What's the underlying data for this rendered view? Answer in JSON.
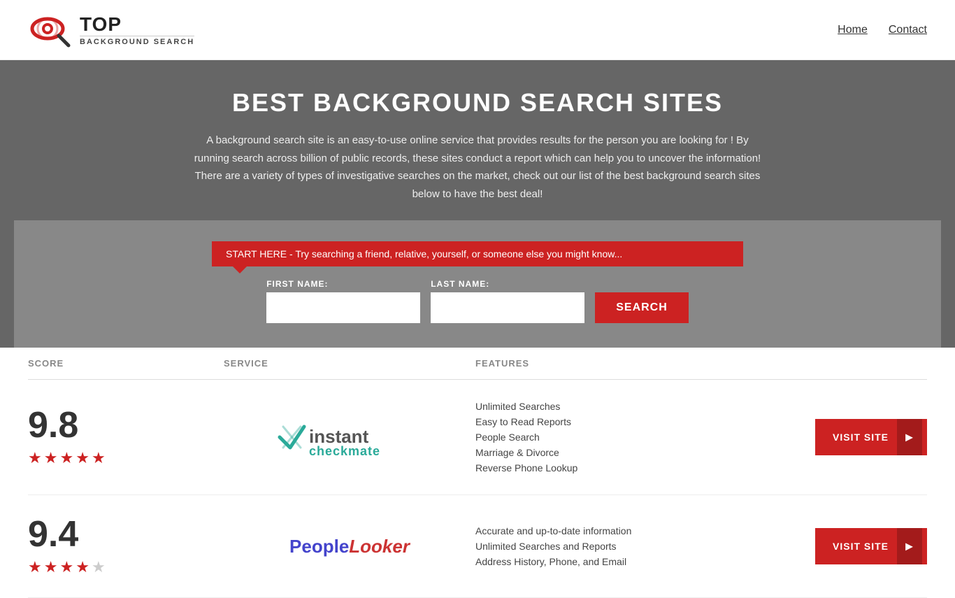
{
  "header": {
    "logo_top": "TOP",
    "logo_sub": "BACKGROUND SEARCH",
    "nav": [
      {
        "label": "Home",
        "href": "#"
      },
      {
        "label": "Contact",
        "href": "#"
      }
    ]
  },
  "hero": {
    "title": "BEST BACKGROUND SEARCH SITES",
    "description": "A background search site is an easy-to-use online service that provides results  for the person you are looking for ! By  running  search across billion of public records, these sites conduct  a report which can help you to uncover the information! There are a variety of types of investigative searches on the market, check out our  list of the best background search sites below to have the best deal!",
    "callout": "START HERE - Try searching a friend, relative, yourself, or someone else you might know...",
    "first_name_label": "FIRST NAME:",
    "last_name_label": "LAST NAME:",
    "search_button": "SEARCH"
  },
  "table": {
    "columns": {
      "score": "SCORE",
      "service": "SERVICE",
      "features": "FEATURES"
    },
    "rows": [
      {
        "score": "9.8",
        "stars": [
          true,
          true,
          true,
          true,
          true
        ],
        "service_name": "Instant Checkmate",
        "service_type": "checkmate",
        "features": [
          "Unlimited Searches",
          "Easy to Read Reports",
          "People Search",
          "Marriage & Divorce",
          "Reverse Phone Lookup"
        ],
        "visit_label": "VISIT SITE"
      },
      {
        "score": "9.4",
        "stars": [
          true,
          true,
          true,
          true,
          false
        ],
        "service_name": "PeopleLooker",
        "service_type": "peoplelooker",
        "features": [
          "Accurate and up-to-date information",
          "Unlimited Searches and Reports",
          "Address History, Phone, and Email"
        ],
        "visit_label": "VISIT SITE"
      }
    ]
  }
}
